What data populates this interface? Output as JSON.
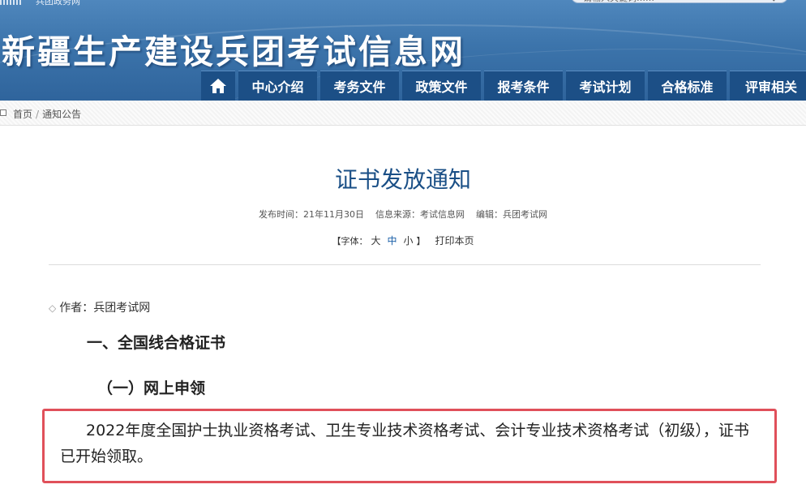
{
  "topbar": {
    "link_label": "兵团政务网",
    "search_placeholder": "请输入关键词……"
  },
  "site": {
    "title": "新疆生产建设兵团考试信息网"
  },
  "nav": {
    "items": [
      {
        "label": "中心介绍"
      },
      {
        "label": "考务文件"
      },
      {
        "label": "政策文件"
      },
      {
        "label": "报考条件"
      },
      {
        "label": "考试计划"
      },
      {
        "label": "合格标准"
      },
      {
        "label": "评审相关"
      }
    ]
  },
  "breadcrumb": {
    "home": "首页",
    "current": "通知公告"
  },
  "article": {
    "title": "证书发放通知",
    "publish_time": "发布时间：21年11月30日",
    "source": "信息来源：考试信息网",
    "editor": "编辑：兵团考试网",
    "font_label_open": "【字体：",
    "font_large": "大",
    "font_medium": "中",
    "font_small": "小",
    "font_label_close": "】",
    "print_label": "打印本页",
    "author": "作者：兵团考试网",
    "heading1": "一、全国线合格证书",
    "heading2": "（一）网上申领",
    "paragraph": "2022年度全国护士执业资格考试、卫生专业技术资格考试、会计专业技术资格考试（初级），证书已开始领取。"
  },
  "colors": {
    "banner": "#3c74ab",
    "nav": "#1c4f86",
    "title": "#1a4f86",
    "highlight": "#e0505a"
  }
}
